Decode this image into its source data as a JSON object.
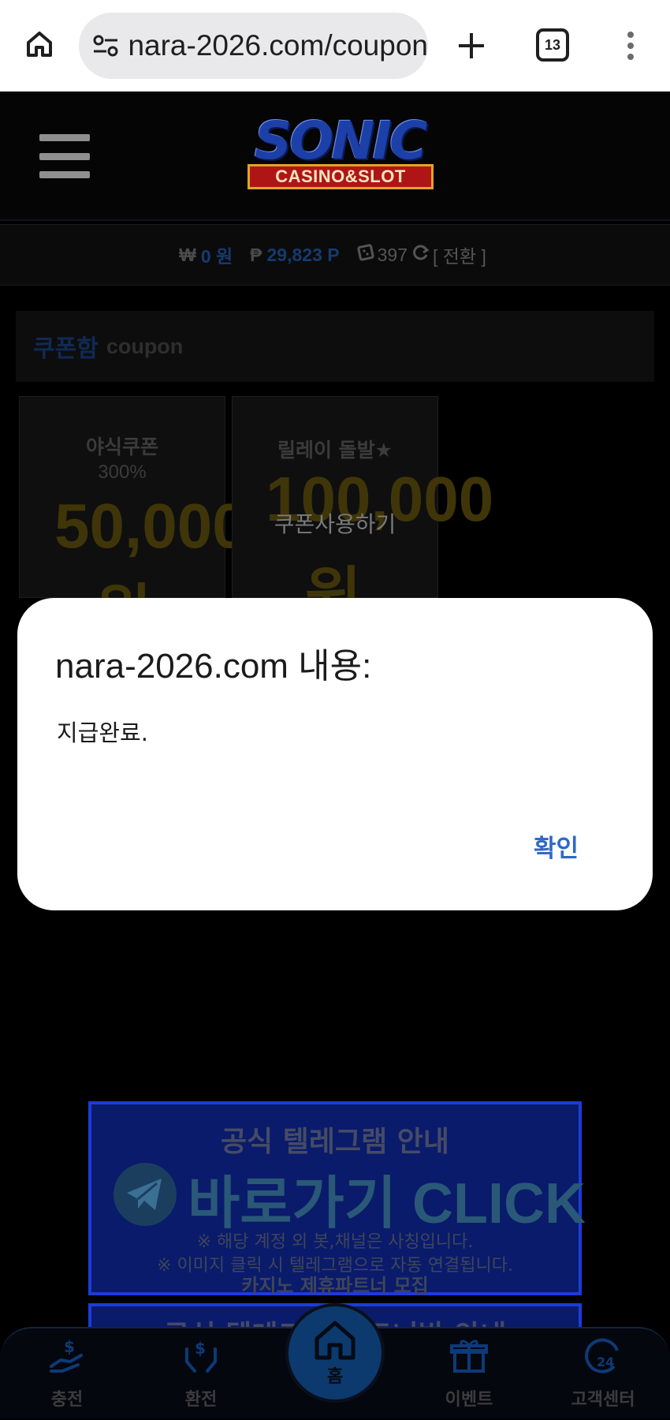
{
  "browser": {
    "url": "nara-2026.com/coupon",
    "tab_count": "13",
    "icons": [
      "home-icon",
      "site-info-icon",
      "plus-icon",
      "tabs-icon",
      "more-vert-icon"
    ]
  },
  "header": {
    "logo_main": "SONIC",
    "logo_sub": "CASINO&SLOT"
  },
  "balance": {
    "won_symbol": "₩",
    "won_value": "0 원",
    "point_symbol": "₱",
    "point_value": "29,823 P",
    "chip_value": "397",
    "convert_label": "[ 전환 ]"
  },
  "coupon_section": {
    "title": "쿠폰함",
    "subtitle": "coupon"
  },
  "coupons": [
    {
      "name": "야식쿠폰",
      "percent": "300%",
      "amount": "50,000",
      "unit": "원"
    },
    {
      "name": "릴레이 돌발★",
      "amount": "100,000",
      "unit": "원",
      "action": "쿠폰사용하기"
    }
  ],
  "dialog": {
    "title": "nara-2026.com 내용:",
    "message": "지급완료.",
    "ok_label": "확인"
  },
  "banner": {
    "top": "공식 텔레그램 안내",
    "click": "바로가기 CLICK",
    "note1": "※ 해당 계정 외 봇,채널은 사칭입니다.",
    "note2": "※ 이미지 클릭 시 텔레그램으로 자동 연결됩니다.",
    "partner": "카지노 제휴파트너 모집",
    "second_top": "공식 텔레그램 파트너방 안내"
  },
  "bottom_nav": {
    "charge": "충전",
    "exchange": "환전",
    "home": "홈",
    "event": "이벤트",
    "support": "고객센터"
  },
  "colors": {
    "accent_blue": "#2f69c8",
    "gold_dimmed": "#3f3508",
    "background": "#000000"
  }
}
